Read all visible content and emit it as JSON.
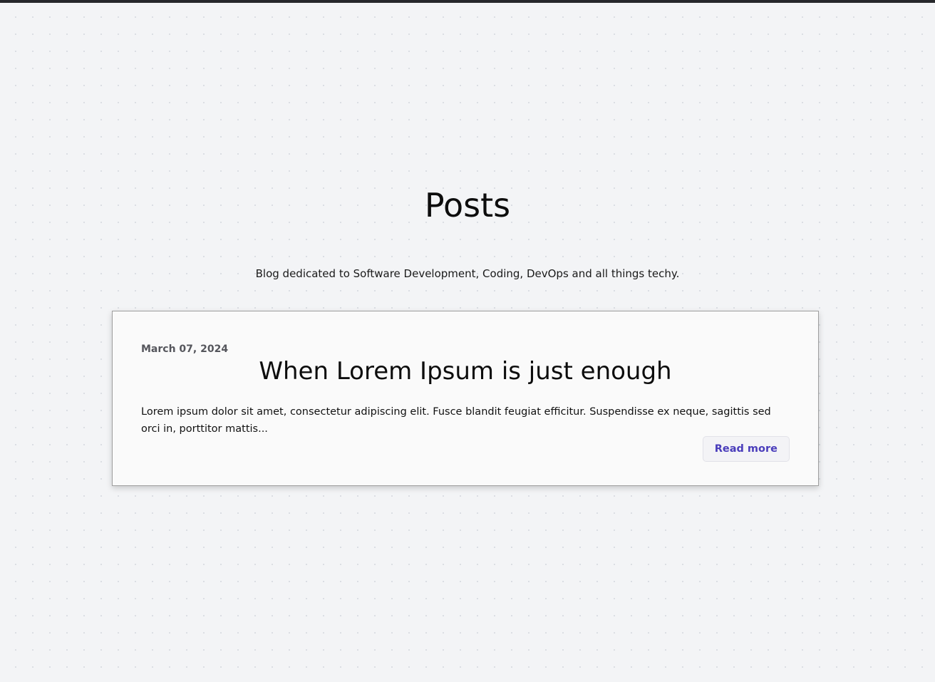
{
  "header": {
    "title": "Posts",
    "subtitle": "Blog dedicated to Software Development, Coding, DevOps and all things techy."
  },
  "posts": [
    {
      "date": "March 07, 2024",
      "title": "When Lorem Ipsum is just enough",
      "excerpt": "Lorem ipsum dolor sit amet, consectetur adipiscing elit. Fusce blandit feugiat efficitur. Suspendisse ex neque, sagittis sed orci in, porttitor mattis...",
      "read_more_label": "Read more"
    }
  ],
  "colors": {
    "accent": "#4a3dbb",
    "background": "#f3f4f6",
    "top_bar": "#26272b"
  }
}
